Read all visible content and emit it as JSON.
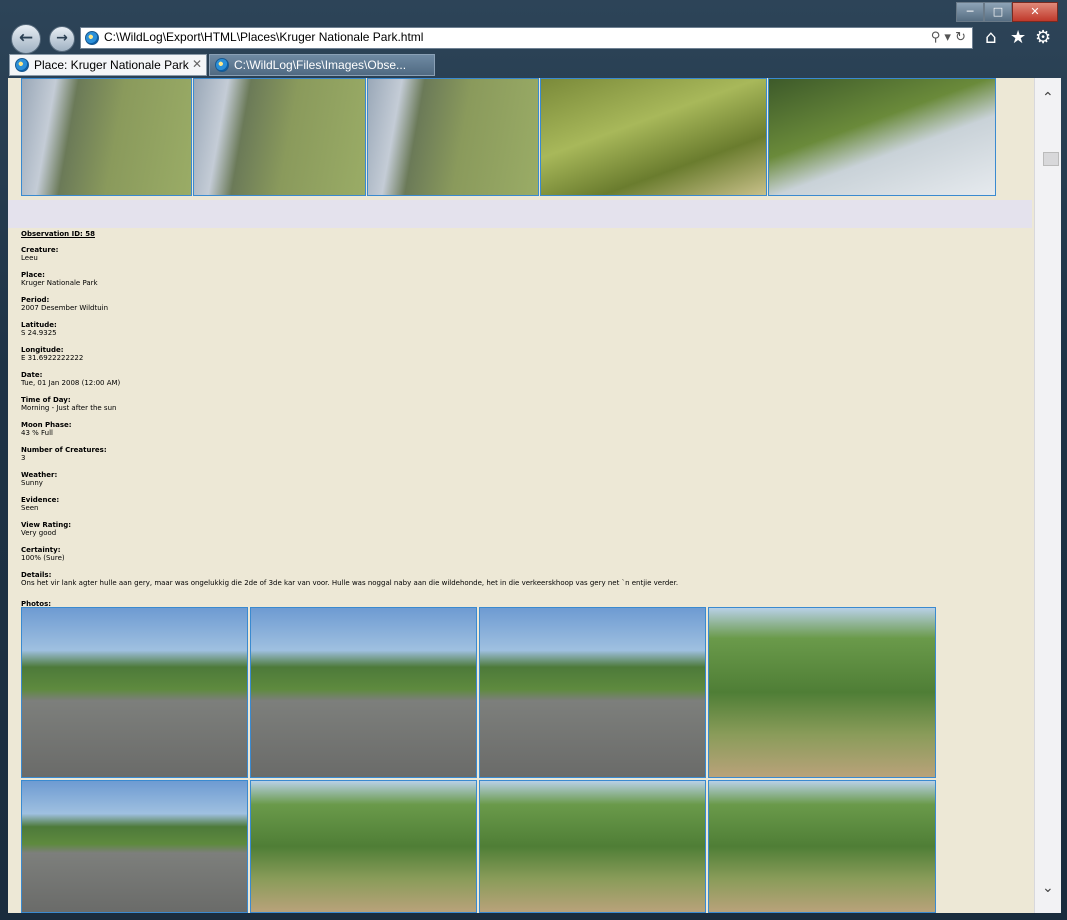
{
  "browser": {
    "address": "C:\\WildLog\\Export\\HTML\\Places\\Kruger Nationale Park.html",
    "tabs": [
      {
        "label": "Place: Kruger Nationale Park"
      },
      {
        "label": "C:\\WildLog\\Files\\Images\\Obse..."
      }
    ],
    "icons": {
      "back": "back-arrow-icon",
      "forward": "forward-arrow-icon",
      "home": "home-icon",
      "favorites": "star-icon",
      "tools": "gear-icon"
    }
  },
  "observation": {
    "heading": "Observation ID: 58",
    "fields": [
      {
        "label": "Creature:",
        "value": "Leeu"
      },
      {
        "label": "Place:",
        "value": "Kruger Nationale Park"
      },
      {
        "label": "Period:",
        "value": "2007 Desember Wildtuin"
      },
      {
        "label": "Latitude:",
        "value": "S 24.9325"
      },
      {
        "label": "Longitude:",
        "value": "E 31.6922222222"
      },
      {
        "label": "Date:",
        "value": "Tue, 01 Jan 2008 (12:00 AM)"
      },
      {
        "label": "Time of Day:",
        "value": "Morning - Just after the sun"
      },
      {
        "label": "Moon Phase:",
        "value": "43 % Full"
      },
      {
        "label": "Number of Creatures:",
        "value": "3"
      },
      {
        "label": "Weather:",
        "value": "Sunny"
      },
      {
        "label": "Evidence:",
        "value": "Seen"
      },
      {
        "label": "View Rating:",
        "value": "Very good"
      },
      {
        "label": "Certainty:",
        "value": "100% (Sure)"
      },
      {
        "label": "Details:",
        "value": "Ons het vir lank agter hulle aan gery, maar was ongelukkig die 2de of 3de kar van voor. Hulle was noggal naby aan die wildehonde, het in die verkeerskhoop vas gery net `n entjie verder."
      }
    ],
    "photos_label": "Photos:"
  }
}
